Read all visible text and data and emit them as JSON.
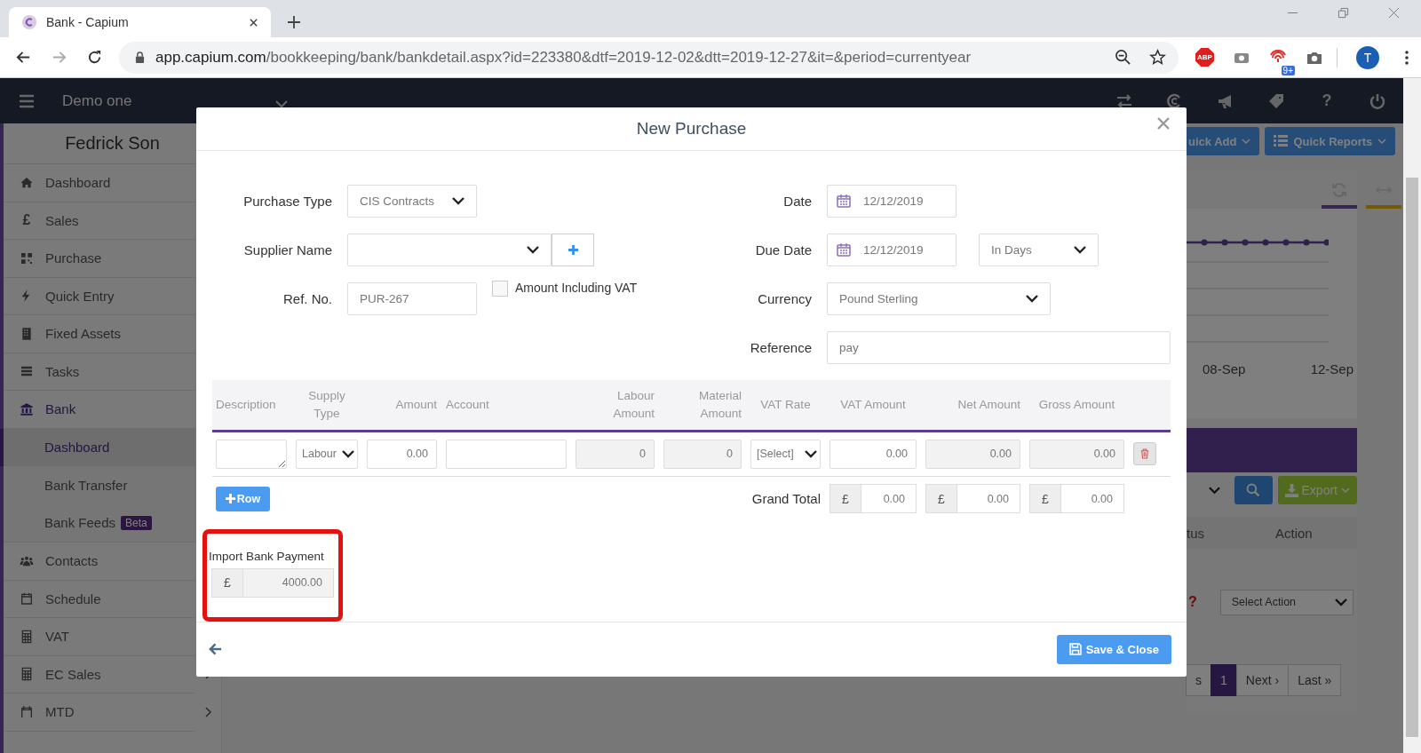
{
  "browser": {
    "tab_title": "Bank - Capium",
    "url_host": "app.capium.com",
    "url_path": "/bookkeeping/bank/bankdetail.aspx?id=223380&dtf=2019-12-02&dtt=2019-12-27&it=&period=currentyear",
    "adblock_label": "ABP",
    "extension_badge": "9+",
    "profile_initial": "T"
  },
  "app_header": {
    "company": "Demo one",
    "help": "?"
  },
  "sidebar": {
    "user": "Fedrick Son",
    "items": [
      {
        "label": "Dashboard",
        "kind": "link",
        "selected": false
      },
      {
        "label": "Sales",
        "kind": "link",
        "icon_text": "£",
        "selected": false
      },
      {
        "label": "Purchase",
        "kind": "link",
        "selected": false
      },
      {
        "label": "Quick Entry",
        "kind": "link",
        "selected": false
      },
      {
        "label": "Fixed Assets",
        "kind": "link",
        "selected": false
      },
      {
        "label": "Tasks",
        "kind": "link",
        "selected": false
      },
      {
        "label": "Bank",
        "kind": "section",
        "selected": true,
        "children": [
          {
            "label": "Dashboard",
            "selected": true
          },
          {
            "label": "Bank Transfer",
            "selected": false
          },
          {
            "label": "Bank Feeds",
            "badge": "Beta",
            "selected": false
          }
        ]
      },
      {
        "label": "Contacts",
        "kind": "link",
        "selected": false
      },
      {
        "label": "Schedule",
        "kind": "link",
        "selected": false
      },
      {
        "label": "VAT",
        "kind": "link",
        "selected": false
      },
      {
        "label": "EC Sales",
        "kind": "menu",
        "selected": false
      },
      {
        "label": "MTD",
        "kind": "menu",
        "selected": false
      }
    ]
  },
  "background_page": {
    "quick_add": "uick Add",
    "quick_reports": "Quick Reports",
    "chart_labels": [
      "08-Sep",
      "12-Sep"
    ],
    "export": "Export",
    "table_headers": [
      "tus",
      "Action"
    ],
    "status_mark": "?",
    "action_select": "Select Action",
    "pagination": [
      {
        "label": "s",
        "selected": false
      },
      {
        "label": "1",
        "selected": true
      },
      {
        "label": "Next ›",
        "selected": false
      },
      {
        "label": "Last »",
        "selected": false
      }
    ]
  },
  "modal": {
    "title": "New Purchase",
    "form_left": [
      {
        "label": "Purchase Type",
        "kind": "select",
        "value": "CIS Contracts"
      },
      {
        "label": "Supplier Name",
        "kind": "select_add"
      },
      {
        "label": "Ref. No.",
        "kind": "text",
        "value": "PUR-267",
        "checkbox": {
          "label": "Amount Including VAT",
          "checked": false
        }
      }
    ],
    "form_right": [
      {
        "label": "Date",
        "kind": "date",
        "value": "12/12/2019"
      },
      {
        "label": "Due Date",
        "kind": "date",
        "value": "12/12/2019",
        "extra_select": "In Days"
      },
      {
        "label": "Currency",
        "kind": "select",
        "value": "Pound Sterling"
      },
      {
        "label": "Reference",
        "kind": "text",
        "value": "pay"
      }
    ],
    "table": {
      "columns": [
        "Description",
        "Supply Type",
        "Amount",
        "Account",
        "Labour Amount",
        "Material Amount",
        "VAT Rate",
        "VAT Amount",
        "Net Amount",
        "Gross Amount"
      ],
      "rows": [
        {
          "cells": [
            {
              "kind": "textarea"
            },
            {
              "kind": "select",
              "value": "Labour"
            },
            {
              "kind": "input",
              "value": "0.00",
              "disabled": false
            },
            {
              "kind": "input",
              "disabled": false
            },
            {
              "kind": "input",
              "value": "0",
              "disabled": true
            },
            {
              "kind": "input",
              "value": "0",
              "disabled": true
            },
            {
              "kind": "select",
              "value": "[Select]"
            },
            {
              "kind": "input",
              "value": "0.00",
              "disabled": false
            },
            {
              "kind": "input",
              "value": "0.00",
              "disabled": true
            },
            {
              "kind": "input",
              "value": "0.00",
              "disabled": true
            },
            {
              "kind": "delete"
            }
          ]
        }
      ],
      "add_row_button": "Row",
      "grand_total": {
        "label": "Grand Total",
        "totals": [
          {
            "currency": "£",
            "value": "0.00"
          },
          {
            "currency": "£",
            "value": "0.00"
          },
          {
            "currency": "£",
            "value": "0.00"
          }
        ]
      }
    },
    "import_bank_payment": {
      "label": "Import Bank Payment",
      "currency": "£",
      "value": "4000.00",
      "highlighted": true
    },
    "save_button": "Save & Close"
  }
}
